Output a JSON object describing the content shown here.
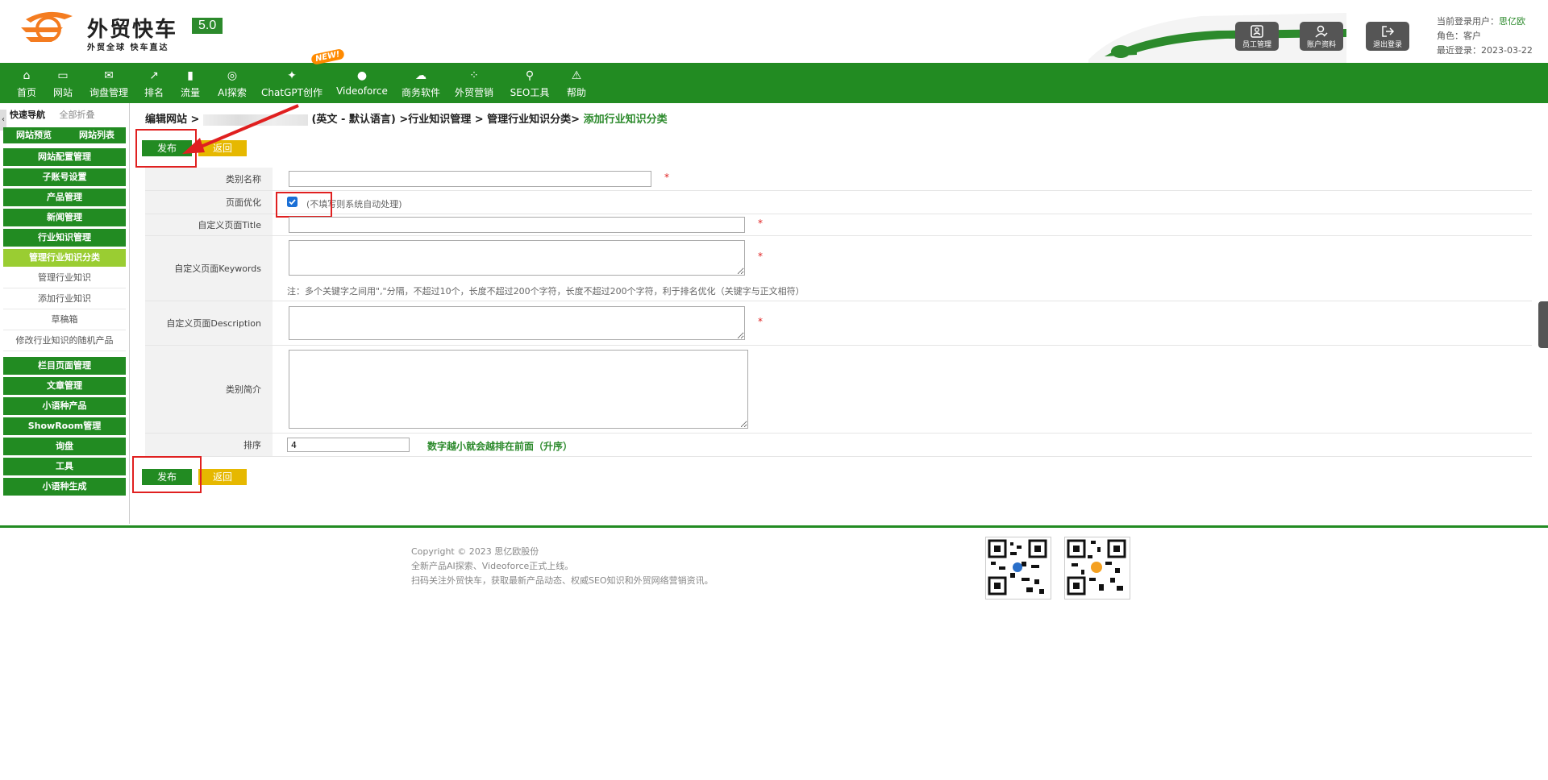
{
  "brand": {
    "name": "外贸快车",
    "version": "5.0",
    "slogan": "外贸全球 快车直达"
  },
  "header_buttons": [
    {
      "label": "员工管理",
      "icon": "contact-card-icon"
    },
    {
      "label": "账户资料",
      "icon": "user-edit-icon"
    },
    {
      "label": "退出登录",
      "icon": "logout-icon"
    }
  ],
  "user": {
    "login_label": "当前登录用户：",
    "login_name": "思亿欧",
    "role": "角色：客户",
    "last_login": "最近登录：2023-03-22"
  },
  "nav": [
    {
      "label": "首页",
      "icon": "home-icon"
    },
    {
      "label": "网站",
      "icon": "monitor-icon"
    },
    {
      "label": "询盘管理",
      "icon": "mail-icon"
    },
    {
      "label": "排名",
      "icon": "ranking-icon"
    },
    {
      "label": "流量",
      "icon": "bar-chart-icon"
    },
    {
      "label": "AI探索",
      "icon": "ai-icon"
    },
    {
      "label": "ChatGPT创作",
      "icon": "chatgpt-icon"
    },
    {
      "label": "Videoforce",
      "icon": "video-icon"
    },
    {
      "label": "商务软件",
      "icon": "cloud-icon"
    },
    {
      "label": "外贸营销",
      "icon": "grid-icon"
    },
    {
      "label": "SEO工具",
      "icon": "search-icon"
    },
    {
      "label": "帮助",
      "icon": "warning-icon"
    }
  ],
  "new_badge": "NEW!",
  "sidebar": {
    "collapse": "‹",
    "tabs": [
      "快速导航",
      "全部折叠"
    ],
    "top_links": [
      "网站预览",
      "网站列表"
    ],
    "items": [
      {
        "label": "网站配置管理",
        "type": "group"
      },
      {
        "label": "子账号设置",
        "type": "group"
      },
      {
        "label": "产品管理",
        "type": "group"
      },
      {
        "label": "新闻管理",
        "type": "group"
      },
      {
        "label": "行业知识管理",
        "type": "group"
      },
      {
        "label": "管理行业知识分类",
        "type": "active"
      },
      {
        "label": "管理行业知识",
        "type": "sub"
      },
      {
        "label": "添加行业知识",
        "type": "sub"
      },
      {
        "label": "草稿箱",
        "type": "sub"
      },
      {
        "label": "修改行业知识的随机产品",
        "type": "sub"
      },
      {
        "label": "栏目页面管理",
        "type": "group"
      },
      {
        "label": "文章管理",
        "type": "group"
      },
      {
        "label": "小语种产品",
        "type": "group"
      },
      {
        "label": "ShowRoom管理",
        "type": "group"
      },
      {
        "label": "询盘",
        "type": "group"
      },
      {
        "label": "工具",
        "type": "group"
      },
      {
        "label": "小语种生成",
        "type": "group"
      }
    ]
  },
  "breadcrumb": {
    "prefix": "编辑网站 >",
    "middle": "(英文 - 默认语言) >行业知识管理 > 管理行业知识分类>",
    "current": "添加行业知识分类"
  },
  "buttons": {
    "publish": "发布",
    "back": "返回"
  },
  "form": {
    "category_name_label": "类别名称",
    "page_opt_label": "页面优化",
    "page_opt_hint": "(不填写则系统自动处理)",
    "title_label": "自定义页面Title",
    "keywords_label": "自定义页面Keywords",
    "keywords_note": "注：多个关键字之间用\",\"分隔，不超过10个，长度不超过200个字符，长度不超过200个字符，利于排名优化（关键字与正文相符）",
    "description_label": "自定义页面Description",
    "intro_label": "类别简介",
    "sort_label": "排序",
    "sort_value": "4",
    "sort_note": "数字越小就会越排在前面（升序）",
    "required_mark": "*"
  },
  "footer": {
    "lines": [
      "Copyright © 2023 思亿欧股份",
      "全新产品AI探索、Videoforce正式上线。",
      "扫码关注外贸快车，获取最新产品动态、权威SEO知识和外贸网络营销资讯。"
    ]
  },
  "colors": {
    "primary": "#228b22",
    "active": "#9acd32",
    "back": "#e6b800",
    "annotation": "#e02020"
  }
}
